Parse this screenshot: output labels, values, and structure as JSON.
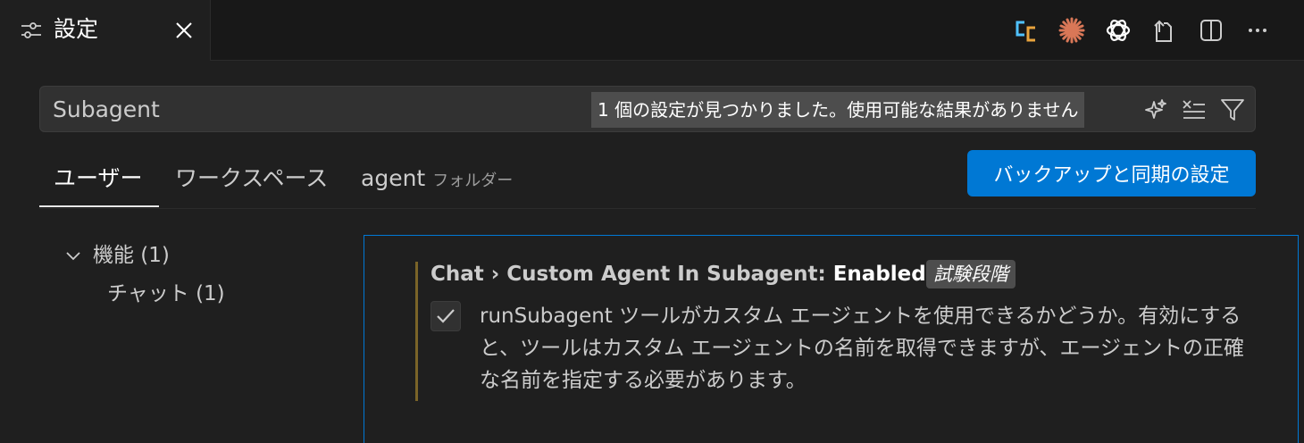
{
  "tab": {
    "title": "設定"
  },
  "toolbar": {
    "icons": [
      "copilot-compare-icon",
      "claude-icon",
      "openai-icon",
      "open-file-icon",
      "split-editor-icon",
      "more-actions-icon"
    ],
    "accent_orange": "#d97757"
  },
  "search": {
    "value": "Subagent",
    "result_count": "1 個の設定が見つかりました。使用可能な結果がありません"
  },
  "scope_tabs": [
    {
      "label": "ユーザー"
    },
    {
      "label": "ワークスペース"
    },
    {
      "label": "agent",
      "sublabel": "フォルダー"
    }
  ],
  "sync_button": "バックアップと同期の設定",
  "toc": {
    "group": "機能 (1)",
    "child": "チャット (1)"
  },
  "setting": {
    "title_prefix": "Chat › Custom Agent In Subagent: ",
    "title_value": "Enabled",
    "tag": "試験段階",
    "checked": true,
    "description": "runSubagent ツールがカスタム エージェントを使用できるかどうか。有効にすると、ツールはカスタム エージェントの名前を取得できますが、エージェントの正確な名前を指定する必要があります。"
  },
  "colors": {
    "accent": "#0078d4",
    "modified": "#7a6428"
  }
}
